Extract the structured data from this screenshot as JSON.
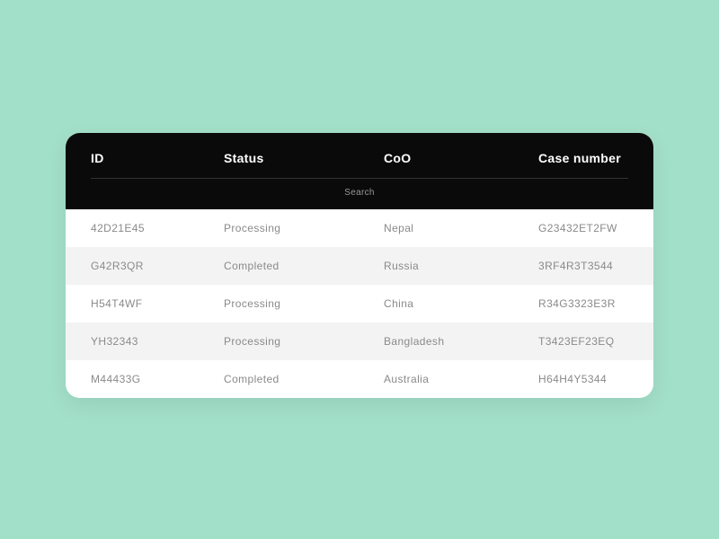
{
  "headers": {
    "id": "ID",
    "status": "Status",
    "coo": "CoO",
    "case": "Case number"
  },
  "search": {
    "placeholder": "Search"
  },
  "rows": [
    {
      "id": "42D21E45",
      "status": "Processing",
      "coo": "Nepal",
      "case": "G23432ET2FW"
    },
    {
      "id": "G42R3QR",
      "status": "Completed",
      "coo": "Russia",
      "case": "3RF4R3T3544"
    },
    {
      "id": "H54T4WF",
      "status": "Processing",
      "coo": "China",
      "case": "R34G3323E3R"
    },
    {
      "id": "YH32343",
      "status": "Processing",
      "coo": "Bangladesh",
      "case": "T3423EF23EQ"
    },
    {
      "id": "M44433G",
      "status": "Completed",
      "coo": "Australia",
      "case": "H64H4Y5344"
    }
  ]
}
